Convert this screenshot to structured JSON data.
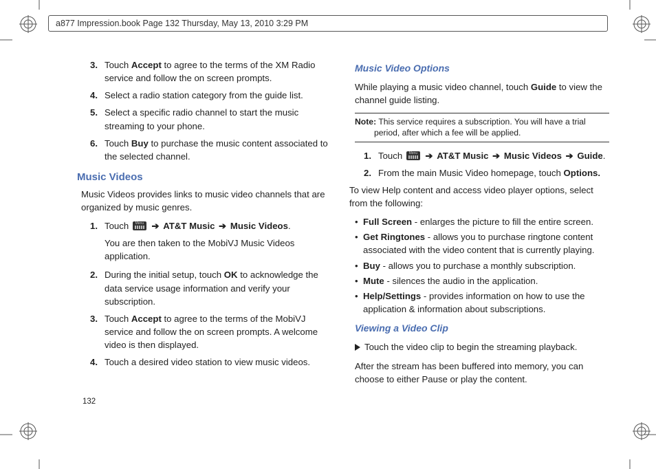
{
  "header": {
    "text": "a877 Impression.book  Page 132  Thursday, May 13, 2010  3:29 PM"
  },
  "page_number": "132",
  "left": {
    "items_top": [
      {
        "n": "3.",
        "pre": "Touch ",
        "b1": "Accept",
        "post": " to agree to the terms of the XM Radio service and follow the on screen prompts."
      },
      {
        "n": "4.",
        "pre": "Select a radio station category from the guide list."
      },
      {
        "n": "5.",
        "pre": "Select a specific radio channel to start the music streaming to your phone."
      },
      {
        "n": "6.",
        "pre": "Touch ",
        "b1": "Buy",
        "post": " to purchase the music content associated to the selected channel."
      }
    ],
    "section": "Music Videos",
    "intro": "Music Videos provides links to music video channels that are organized by music genres.",
    "nav": {
      "n": "1.",
      "pre": "Touch  ",
      "p1": "AT&T Music",
      "p2": "Music Videos",
      "post": "."
    },
    "nav_after": "You are then taken to the MobiVJ Music Videos application.",
    "items_bot": [
      {
        "n": "2.",
        "pre": "During the initial setup, touch ",
        "b1": "OK",
        "post": " to acknowledge the data service usage information and verify your subscription."
      },
      {
        "n": "3.",
        "pre": "Touch ",
        "b1": "Accept",
        "post": " to agree to the terms of the MobiVJ service and follow the on screen prompts. A welcome video is then displayed."
      },
      {
        "n": "4.",
        "pre": "Touch a desired video station to view music videos."
      }
    ]
  },
  "right": {
    "sub1": "Music Video Options",
    "p1a": "While playing a music video channel, touch ",
    "p1b": "Guide",
    "p1c": " to view the channel guide listing.",
    "note_label": "Note:",
    "note": " This service requires a subscription. You will have a trial period, after which a fee will be applied.",
    "nav": {
      "n": "1.",
      "pre": "Touch  ",
      "p1": "AT&T Music",
      "p2": "Music Videos",
      "p3": "Guide",
      "post": "."
    },
    "item2": {
      "n": "2.",
      "pre": "From the main Music Video homepage, touch ",
      "b1": "Options."
    },
    "p2": "To view Help content and access video player options, select from the following:",
    "bullets": [
      {
        "b": "Full Screen",
        "t": " - enlarges the picture to fill the entire screen."
      },
      {
        "b": "Get Ringtones",
        "t": " - allows you to purchase ringtone content associated with the video content that is currently playing."
      },
      {
        "b": "Buy",
        "t": " - allows you to purchase a monthly subscription."
      },
      {
        "b": "Mute",
        "t": " - silences the audio in the application."
      },
      {
        "b": "Help/Settings",
        "t": " - provides information on how to use the application & information about subscriptions."
      }
    ],
    "sub2": "Viewing a Video Clip",
    "tri": "Touch the video clip to begin the streaming playback.",
    "p3": "After the stream has been buffered into memory, you can choose to either Pause or play the content."
  }
}
